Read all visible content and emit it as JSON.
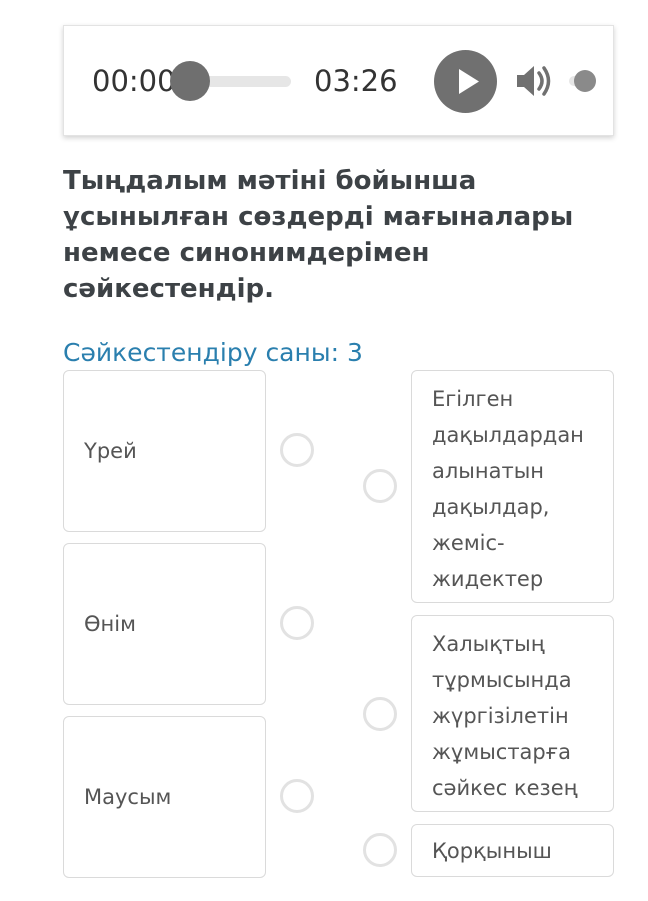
{
  "player": {
    "current_time": "00:00",
    "duration": "03:26",
    "progress": 0,
    "volume_level": 1
  },
  "question": {
    "text": "Тыңдалым мәтіні бойынша ұсынылған сөздерді мағыналары немесе синонимдерімен сәйкестендір.",
    "match_count": "Сәйкестендіру саны: 3"
  },
  "left_items": [
    {
      "label": "Үрей"
    },
    {
      "label": "Өнім"
    },
    {
      "label": "Маусым"
    }
  ],
  "right_items": [
    {
      "label": "Егілген дақылдардан алынатын дақылдар, жеміс-жидектер"
    },
    {
      "label": "Халықтың тұрмысында жүргізілетін жұмыстарға сәйкес кезең"
    },
    {
      "label": "Қорқыныш"
    }
  ],
  "colors": {
    "accent": "#2a7fae",
    "control": "#707070"
  },
  "icons": [
    "play-icon",
    "volume-icon"
  ]
}
